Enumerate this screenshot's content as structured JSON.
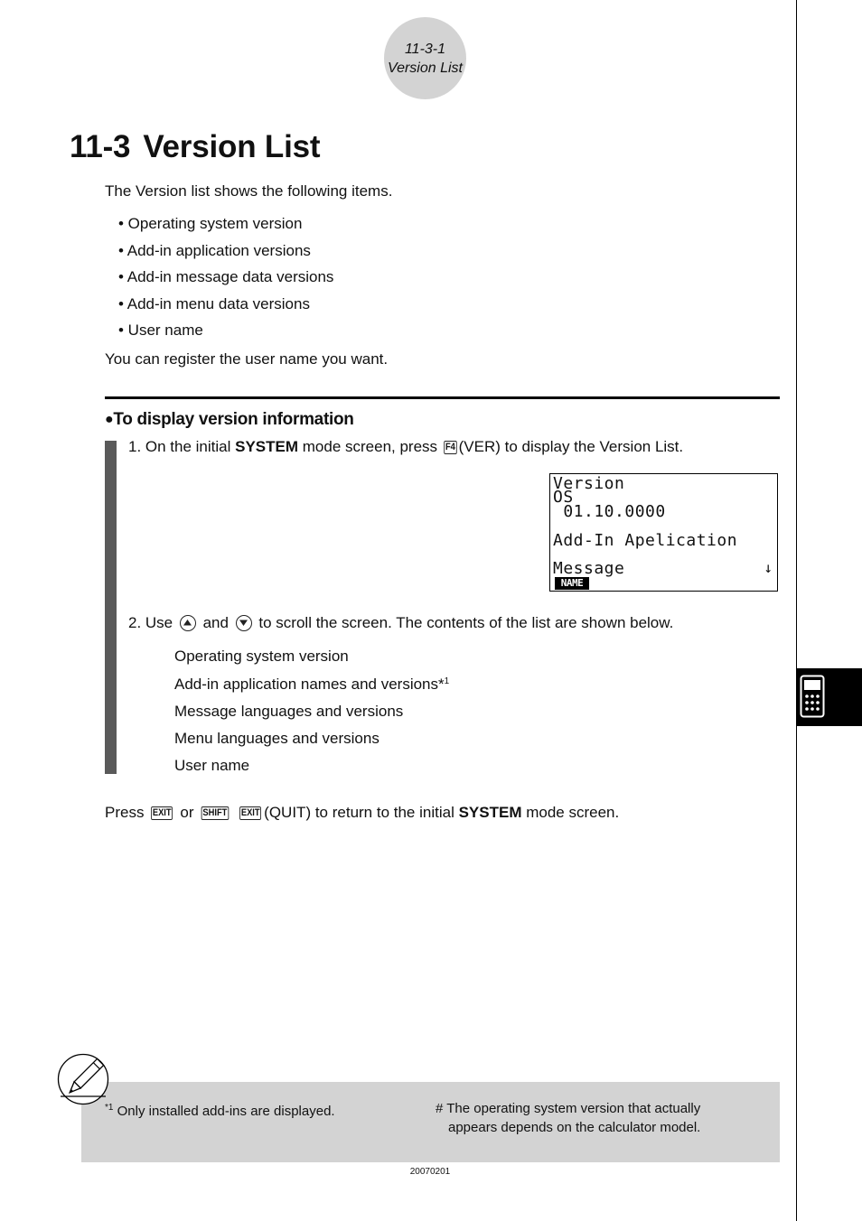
{
  "header": {
    "page_number": "11-3-1",
    "page_title": "Version List"
  },
  "title": {
    "number": "11-3",
    "text": "Version List"
  },
  "intro": "The Version list shows the following items.",
  "items": [
    "• Operating system version",
    "• Add-in application versions",
    "• Add-in message data versions",
    "• Add-in menu data versions",
    "• User name"
  ],
  "register_text": "You can register the user name you want.",
  "section": {
    "heading": "To display version information",
    "step1": {
      "prefix": "1. On the initial ",
      "bold": "SYSTEM",
      "middle": " mode screen, press ",
      "key": "F4",
      "suffix": "(VER) to display the Version List."
    },
    "screen": {
      "lines": [
        "Version",
        "OS",
        " 01.10.0000",
        "Add-In Apelication",
        "Message"
      ],
      "arrow": "↓",
      "function_key": "NAME"
    },
    "step2": {
      "prefix": "2. Use ",
      "up_key": "up-arrow-key",
      "and": " and ",
      "down_key": "down-arrow-key",
      "suffix": " to scroll the screen. The contents of the list are shown below."
    },
    "contents": [
      {
        "text": "Operating system version",
        "footnote": ""
      },
      {
        "text": "Add-in application names and versions*",
        "footnote": "1"
      },
      {
        "text": "Message languages and versions",
        "footnote": ""
      },
      {
        "text": "Menu languages and versions",
        "footnote": ""
      },
      {
        "text": "User name",
        "footnote": ""
      }
    ]
  },
  "return_text": {
    "prefix": "Press ",
    "key1": "EXIT",
    "or": " or ",
    "key2": "SHIFT",
    "key3": "EXIT",
    "middle": "(QUIT) to return to the initial ",
    "bold": "SYSTEM",
    "suffix": " mode screen."
  },
  "notes": {
    "footnote_mark": "*1",
    "footnote_text": " Only installed add-ins are displayed.",
    "hash_note_line1": "# The operating system version that actually",
    "hash_note_line2": "appears depends on the calculator model."
  },
  "footer": {
    "code": "20070201"
  },
  "side_tab": {
    "icon": "calculator-icon"
  }
}
